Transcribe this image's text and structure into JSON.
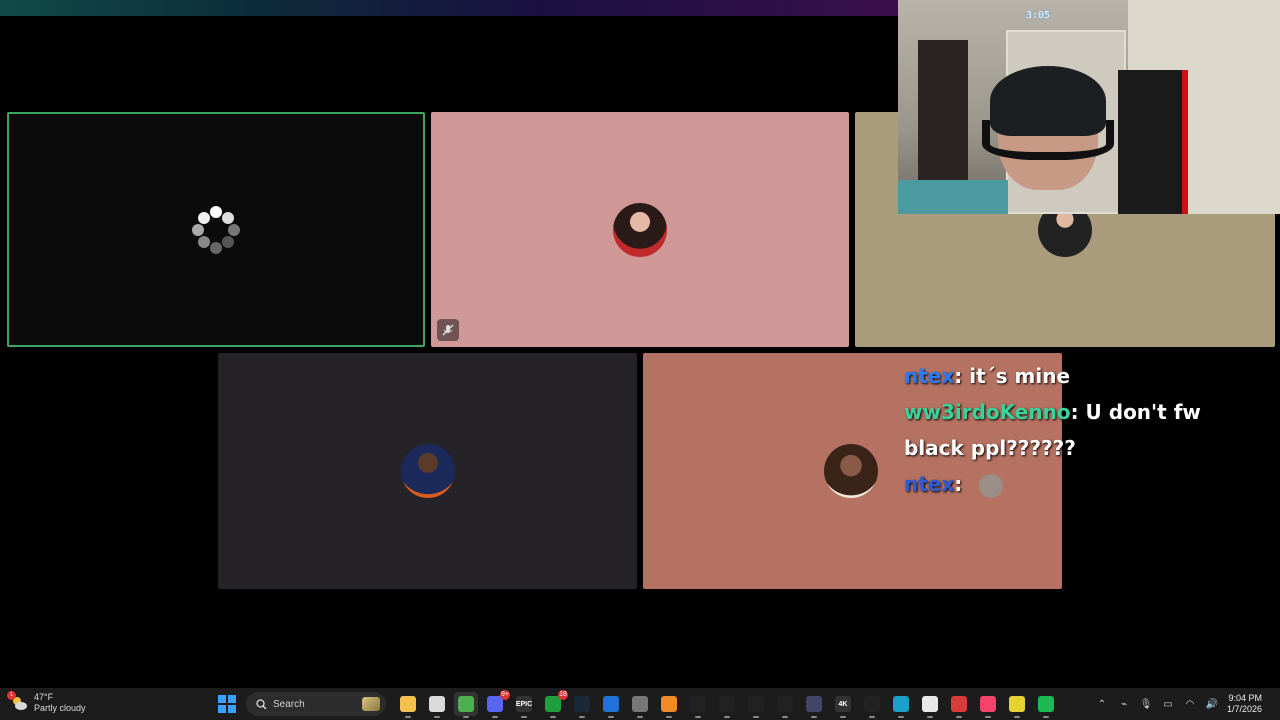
{
  "call": {
    "tiles": [
      {
        "id": "loading",
        "bg": "#0b0b0b",
        "speaking": true,
        "state": "loading"
      },
      {
        "id": "pink",
        "bg": "#cf9897",
        "muted": true
      },
      {
        "id": "tan",
        "bg": "#a99b7c"
      },
      {
        "id": "dark",
        "bg": "#252327"
      },
      {
        "id": "salmon",
        "bg": "#b57161"
      }
    ]
  },
  "webcam": {
    "overlay_time": "3:05"
  },
  "chat": {
    "messages": [
      {
        "user": "ntex",
        "user_color": "#2f7bf5",
        "text": "it´s mine"
      },
      {
        "user": "ww3irdoKenno",
        "user_color": "#3ad19a",
        "text": "U don't fw black ppl??????"
      },
      {
        "user": "ntex",
        "user_color": "#2f5bd5",
        "text": "",
        "emote": "emote-icon"
      }
    ]
  },
  "taskbar": {
    "weather": {
      "temp": "47°F",
      "condition": "Partly cloudy",
      "badge": "1"
    },
    "search_placeholder": "Search",
    "apps": [
      {
        "name": "file-explorer-icon",
        "color": "#f2c14e"
      },
      {
        "name": "store-icon",
        "color": "#dadada"
      },
      {
        "name": "chrome-icon",
        "color": "#4caf50",
        "active": true
      },
      {
        "name": "discord-icon",
        "color": "#5865f2",
        "badge": "9+"
      },
      {
        "name": "epic-games-icon",
        "color": "#333333",
        "label": "EPIC"
      },
      {
        "name": "xbox-icon",
        "color": "#1e9f3c",
        "badge": "18"
      },
      {
        "name": "steam-icon",
        "color": "#1b2838"
      },
      {
        "name": "browser-icon",
        "color": "#1e73d6"
      },
      {
        "name": "minecraft-icon",
        "color": "#777777"
      },
      {
        "name": "launcher-icon",
        "color": "#f08a24"
      },
      {
        "name": "pen-icon",
        "color": "#222222"
      },
      {
        "name": "obs-icon",
        "color": "#222222"
      },
      {
        "name": "record-icon",
        "color": "#222222"
      },
      {
        "name": "capcut-icon",
        "color": "#222222"
      },
      {
        "name": "media-icon",
        "color": "#444466"
      },
      {
        "name": "4k-icon",
        "color": "#333333",
        "label": "4K"
      },
      {
        "name": "tool-icon",
        "color": "#222222"
      },
      {
        "name": "c-app-icon",
        "color": "#1aa0c8"
      },
      {
        "name": "roblox-icon",
        "color": "#e8e8e8"
      },
      {
        "name": "shuffle-icon",
        "color": "#d93a3a"
      },
      {
        "name": "music-icon",
        "color": "#f2446a"
      },
      {
        "name": "emoji-app-icon",
        "color": "#e6d230"
      },
      {
        "name": "spotify-icon",
        "color": "#1db954"
      }
    ],
    "time": "9:04 PM",
    "date": "1/7/2026"
  }
}
